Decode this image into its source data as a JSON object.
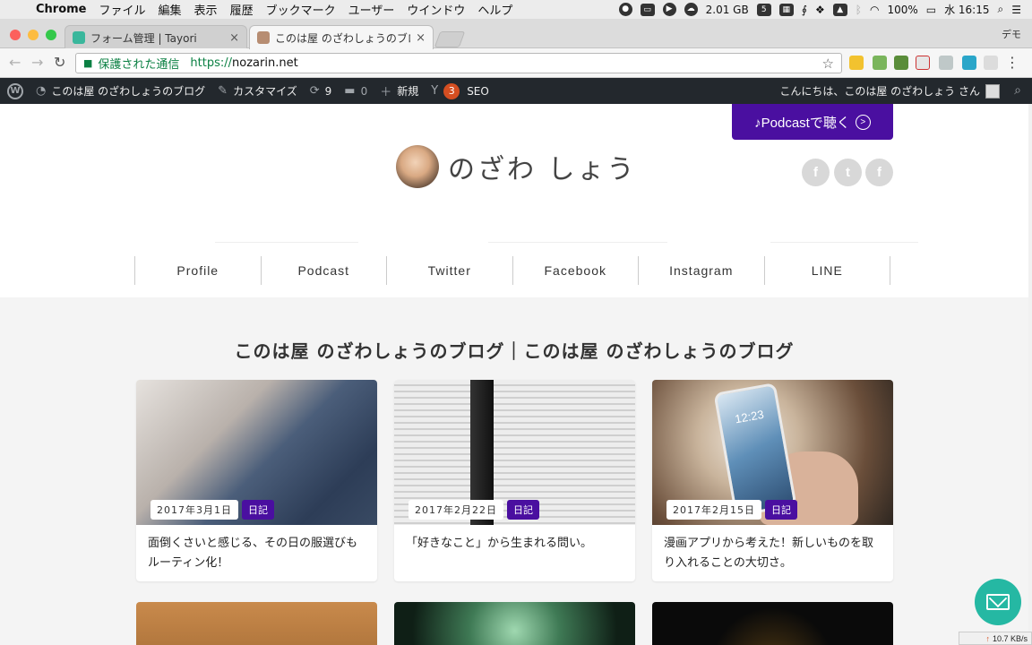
{
  "macos_menubar": {
    "app": "Chrome",
    "menus": [
      "ファイル",
      "編集",
      "表示",
      "履歴",
      "ブックマーク",
      "ユーザー",
      "ウインドウ",
      "ヘルプ"
    ],
    "memory": "2.01 GB",
    "battery": "100%",
    "clock": "水 16:15"
  },
  "tabs": [
    {
      "title": "フォーム管理 | Tayori",
      "active": false
    },
    {
      "title": "このは屋 のざわしょうのブログ",
      "active": true
    }
  ],
  "profile_label": "デモ",
  "omnibox": {
    "secure_label": "保護された通信",
    "scheme": "https://",
    "host": "nozarin.net"
  },
  "admin_bar": {
    "site_name": "このは屋 のざわしょうのブログ",
    "customize": "カスタマイズ",
    "updates_count": "9",
    "comments_count": "0",
    "new_label": "新規",
    "yoast_count": "3",
    "seo_label": "SEO",
    "greeting": "こんにちは、このは屋 のざわしょう さん"
  },
  "header": {
    "podcast_button": "♪Podcastで聴く",
    "podcast_arrow": ">",
    "logo_text": "のざわ しょう",
    "social": {
      "facebook": "f",
      "twitter": "t",
      "feedly": "f"
    }
  },
  "global_nav": [
    "Profile",
    "Podcast",
    "Twitter",
    "Facebook",
    "Instagram",
    "LINE"
  ],
  "section_title": "このは屋 のざわしょうのブログ｜このは屋 のざわしょうのブログ",
  "posts": [
    {
      "date": "2017年3月1日",
      "category": "日記",
      "title": "面倒くさいと感じる、その日の服選びもルーティン化！"
    },
    {
      "date": "2017年2月22日",
      "category": "日記",
      "title": "「好きなこと」から生まれる問い。"
    },
    {
      "date": "2017年2月15日",
      "category": "日記",
      "title": "漫画アプリから考えた！新しいものを取り入れることの大切さ。"
    }
  ],
  "phone_clock": "12:23",
  "net_speed": "10.7 KB/s",
  "colors": {
    "accent_purple": "#4a0fa0",
    "admin_bar": "#23282d",
    "fab_teal": "#25b8a3",
    "secure_green": "#0b8043"
  }
}
